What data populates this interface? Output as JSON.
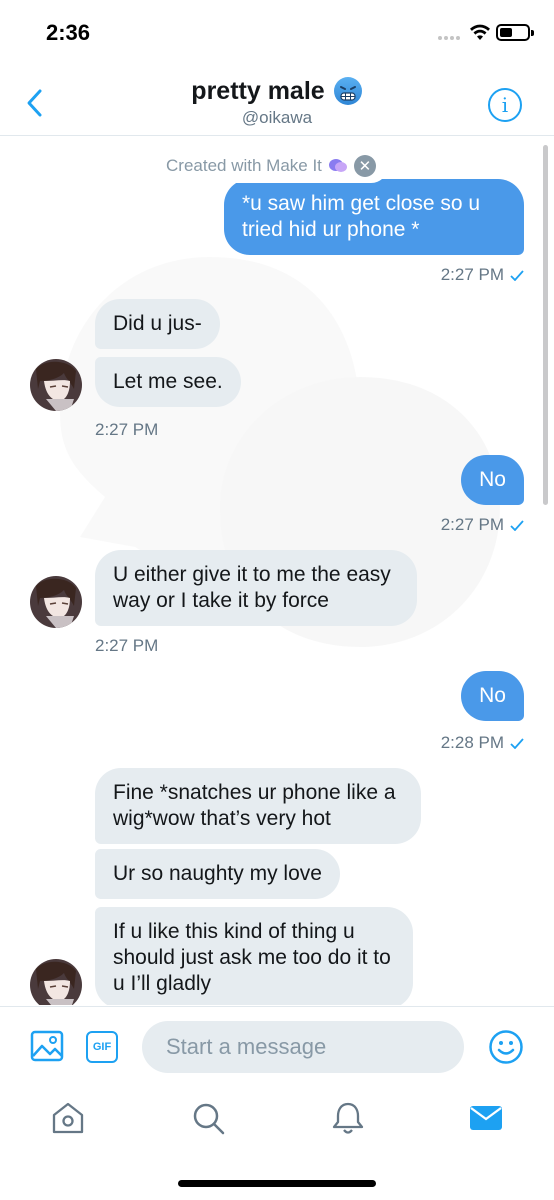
{
  "status_bar": {
    "time": "2:36"
  },
  "header": {
    "title": "pretty male",
    "handle": "@oikawa",
    "title_emoji": "cold-face-emoji"
  },
  "banner": {
    "text": "Created with Make It"
  },
  "messages": [
    {
      "side": "sent",
      "text": "*u saw him get close so u tried hid ur phone *",
      "time": "2:27 PM"
    },
    {
      "side": "recv",
      "text": "Did u jus-"
    },
    {
      "side": "recv",
      "text": "Let me see.",
      "time": "2:27 PM"
    },
    {
      "side": "sent",
      "text": "No",
      "time": "2:27 PM"
    },
    {
      "side": "recv",
      "text": "U either give it to me the easy way or I take it by force",
      "time": "2:27 PM"
    },
    {
      "side": "sent",
      "text": "No",
      "time": "2:28 PM"
    },
    {
      "side": "recv",
      "text": "Fine *snatches ur phone like a wig*wow that’s very hot"
    },
    {
      "side": "recv",
      "text": "Ur so naughty my love"
    },
    {
      "side": "recv",
      "text": "If u like this kind of thing u should just ask me too do it to u I’ll gladly"
    }
  ],
  "composer": {
    "placeholder": "Start a message",
    "gif_label": "GIF"
  },
  "colors": {
    "accent": "#1da1f2",
    "sent_bubble": "#4a99e9",
    "recv_bubble": "#e6ecf0"
  },
  "tabs": [
    "home-icon",
    "search-icon",
    "notifications-icon",
    "messages-icon"
  ]
}
